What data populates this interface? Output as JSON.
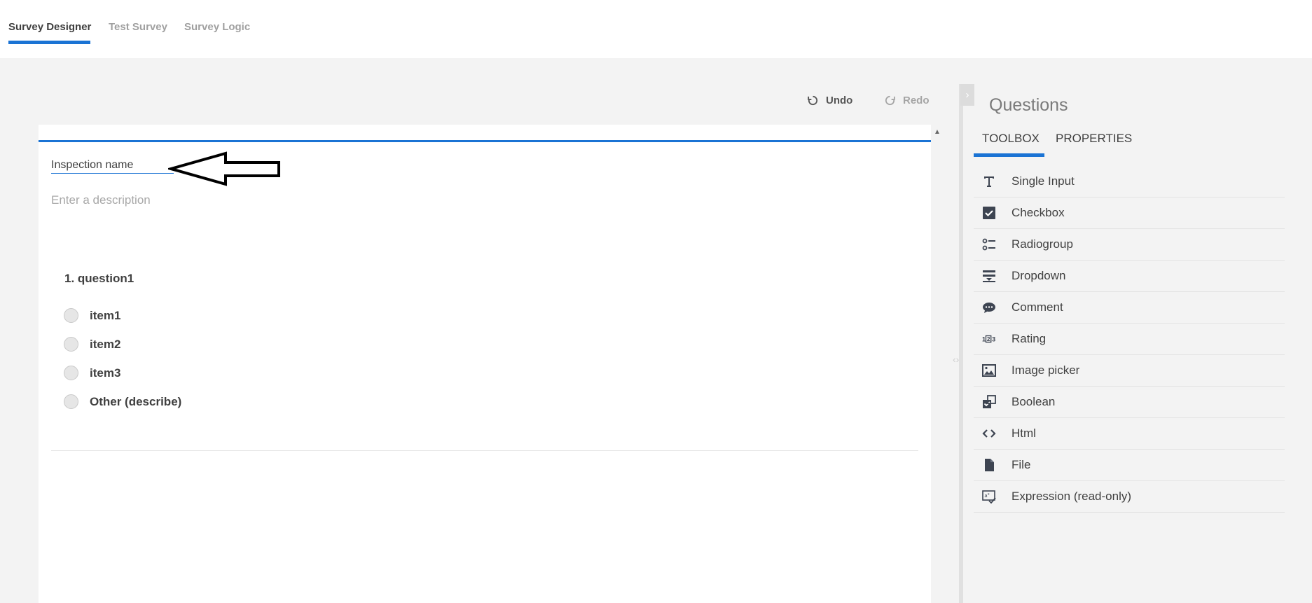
{
  "tabs": [
    {
      "label": "Survey Designer",
      "active": true
    },
    {
      "label": "Test Survey",
      "active": false
    },
    {
      "label": "Survey Logic",
      "active": false
    }
  ],
  "toolbar": {
    "undo_label": "Undo",
    "redo_label": "Redo"
  },
  "survey": {
    "title_value": "Inspection name",
    "description_placeholder": "Enter a description",
    "question": {
      "title": "1. question1",
      "choices": [
        "item1",
        "item2",
        "item3",
        "Other (describe)"
      ]
    }
  },
  "panel": {
    "title": "Questions",
    "tabs": [
      "TOOLBOX",
      "PROPERTIES"
    ],
    "toolbox_items": [
      {
        "label": "Single Input",
        "icon": "text-icon"
      },
      {
        "label": "Checkbox",
        "icon": "checkbox-icon"
      },
      {
        "label": "Radiogroup",
        "icon": "radiogroup-icon"
      },
      {
        "label": "Dropdown",
        "icon": "dropdown-icon"
      },
      {
        "label": "Comment",
        "icon": "comment-icon"
      },
      {
        "label": "Rating",
        "icon": "rating-icon"
      },
      {
        "label": "Image picker",
        "icon": "image-picker-icon"
      },
      {
        "label": "Boolean",
        "icon": "boolean-icon"
      },
      {
        "label": "Html",
        "icon": "html-icon"
      },
      {
        "label": "File",
        "icon": "file-icon"
      },
      {
        "label": "Expression (read-only)",
        "icon": "expression-icon"
      }
    ]
  },
  "colors": {
    "accent": "#1a73d4",
    "icon": "#3d4451"
  }
}
